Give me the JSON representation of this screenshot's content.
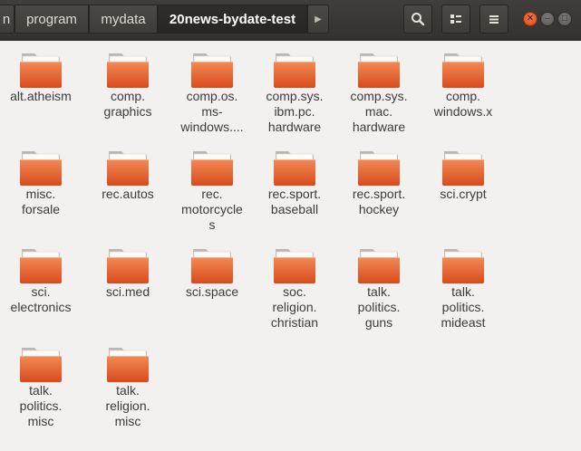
{
  "breadcrumbs": [
    {
      "label": "n"
    },
    {
      "label": "program"
    },
    {
      "label": "mydata"
    },
    {
      "label": "20news-bydate-test"
    }
  ],
  "icons": {
    "next": "chevron-right-icon",
    "search": "search-icon",
    "view": "list-view-icon",
    "menu": "hamburger-menu-icon"
  },
  "colors": {
    "folder_body": "#e0572a",
    "folder_tab": "#f4f4f2",
    "close": "#e8632c"
  },
  "folders": [
    {
      "label": "alt.atheism"
    },
    {
      "label": "comp.\ngraphics"
    },
    {
      "label": "comp.os.\nms-\nwindows...."
    },
    {
      "label": "comp.sys.\nibm.pc.\nhardware"
    },
    {
      "label": "comp.sys.\nmac.\nhardware"
    },
    {
      "label": "comp.\nwindows.x"
    },
    {
      "label": "misc.\nforsale"
    },
    {
      "label": "rec.autos"
    },
    {
      "label": "rec.\nmotorcycle\ns"
    },
    {
      "label": "rec.sport.\nbaseball"
    },
    {
      "label": "rec.sport.\nhockey"
    },
    {
      "label": "sci.crypt"
    },
    {
      "label": "sci.\nelectronics"
    },
    {
      "label": "sci.med"
    },
    {
      "label": "sci.space"
    },
    {
      "label": "soc.\nreligion.\nchristian"
    },
    {
      "label": "talk.\npolitics.\nguns"
    },
    {
      "label": "talk.\npolitics.\nmideast"
    },
    {
      "label": "talk.\npolitics.\nmisc"
    },
    {
      "label": "talk.\nreligion.\nmisc"
    }
  ]
}
